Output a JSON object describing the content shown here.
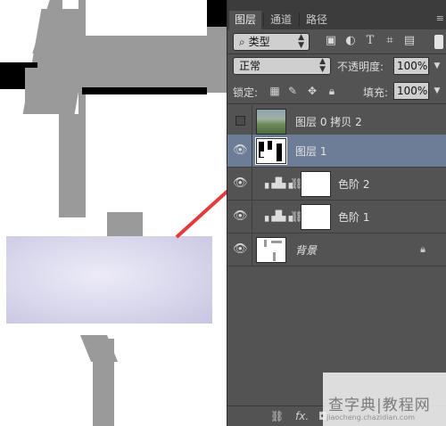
{
  "panel": {
    "tabs": [
      {
        "label": "图层",
        "active": true
      },
      {
        "label": "通道",
        "active": false
      },
      {
        "label": "路径",
        "active": false
      }
    ],
    "filter_kind": "类型",
    "blend_mode": "正常",
    "opacity_label": "不透明度:",
    "opacity_value": "100%",
    "lock_label": "锁定:",
    "fill_label": "填充:",
    "fill_value": "100%",
    "layers": [
      {
        "name": "图层 0 拷贝 2",
        "visible": false,
        "selected": false,
        "thumbnail": "photo"
      },
      {
        "name": "图层 1",
        "visible": true,
        "selected": true,
        "thumbnail": "mask-shape"
      },
      {
        "name": "色阶 2",
        "visible": true,
        "selected": false,
        "thumbnail": "levels-adjustment"
      },
      {
        "name": "色阶 1",
        "visible": true,
        "selected": false,
        "thumbnail": "levels-adjustment"
      },
      {
        "name": "背景",
        "visible": true,
        "selected": false,
        "thumbnail": "background",
        "locked": true
      }
    ],
    "bottom_icons": [
      "link-icon",
      "fx-icon",
      "mask-icon"
    ],
    "bottom_fx_label": "fx."
  },
  "watermark": {
    "title": "查字典|教程网",
    "url": "jiaocheng.chazidian.com"
  },
  "colors": {
    "panel_bg": "#535353",
    "selected_row": "#6d7d97",
    "arrow": "#e33a3a"
  }
}
